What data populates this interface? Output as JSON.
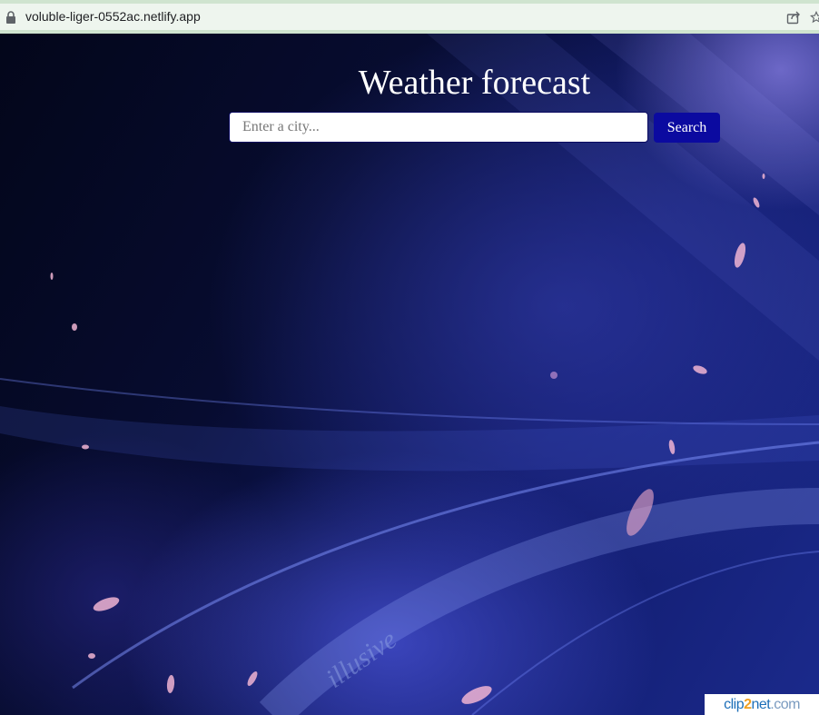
{
  "browser": {
    "url": "voluble-liger-0552ac.netlify.app"
  },
  "page": {
    "title": "Weather forecast",
    "search": {
      "placeholder": "Enter a city...",
      "value": "",
      "button_label": "Search"
    },
    "background_art_text": "illusive"
  },
  "watermark": {
    "part1": "clip",
    "part2": "2",
    "part3": "net",
    "part4": ".com"
  },
  "colors": {
    "search_button": "#0b0aa0",
    "background": "#070c30",
    "title_text": "#ffffff"
  }
}
